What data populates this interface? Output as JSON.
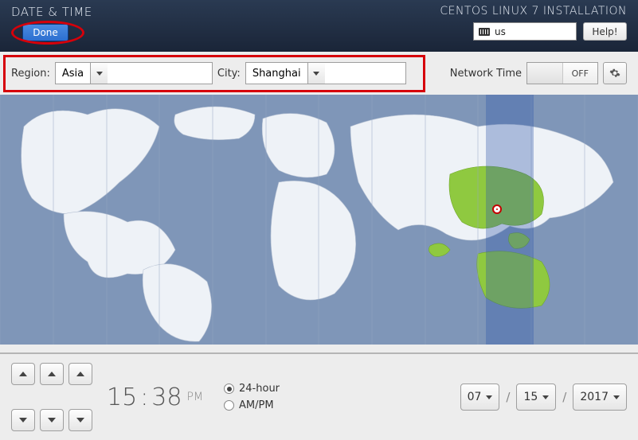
{
  "header": {
    "page_title": "DATE & TIME",
    "done_label": "Done",
    "installer_title": "CENTOS LINUX 7 INSTALLATION",
    "keyboard_layout": "us",
    "help_label": "Help!"
  },
  "toolbar": {
    "region_label": "Region:",
    "region_value": "Asia",
    "city_label": "City:",
    "city_value": "Shanghai",
    "network_time_label": "Network Time",
    "network_time_state": "OFF"
  },
  "time": {
    "hours": "15",
    "minutes": "38",
    "ampm": "PM",
    "format_24": "24-hour",
    "format_12": "AM/PM",
    "selected_format": "24-hour"
  },
  "date": {
    "month": "07",
    "day": "15",
    "year": "2017",
    "sep": "/"
  }
}
